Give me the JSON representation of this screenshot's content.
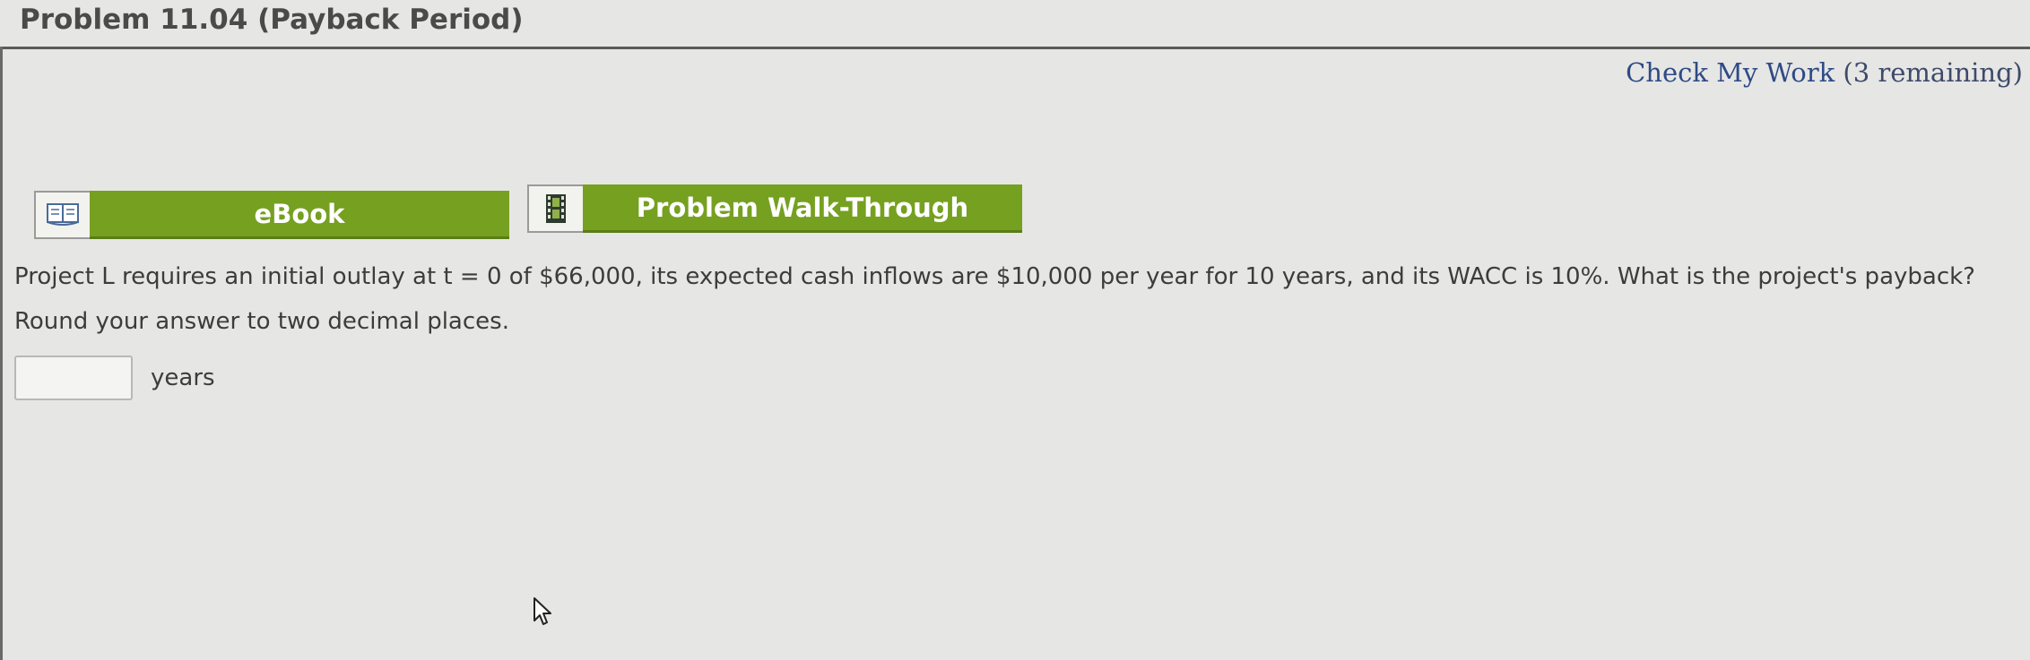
{
  "header": {
    "title": "Problem 11.04 (Payback Period)"
  },
  "check_work": {
    "label": "Check My Work",
    "remaining": "(3 remaining)"
  },
  "buttons": {
    "ebook_icon": "book-icon",
    "ebook_label": "eBook",
    "walkthrough_icon": "film-icon",
    "walkthrough_label": "Problem Walk-Through"
  },
  "question": {
    "text": "Project L requires an initial outlay at t = 0 of $66,000, its expected cash inflows are $10,000 per year for 10 years, and its WACC is 10%. What is the project's payback? Round your answer to two decimal places."
  },
  "answer": {
    "value": "",
    "placeholder": "",
    "unit": "years"
  },
  "colors": {
    "accent_green": "#76a020",
    "link_blue": "#2e4a86",
    "background": "#e6e6e4"
  }
}
